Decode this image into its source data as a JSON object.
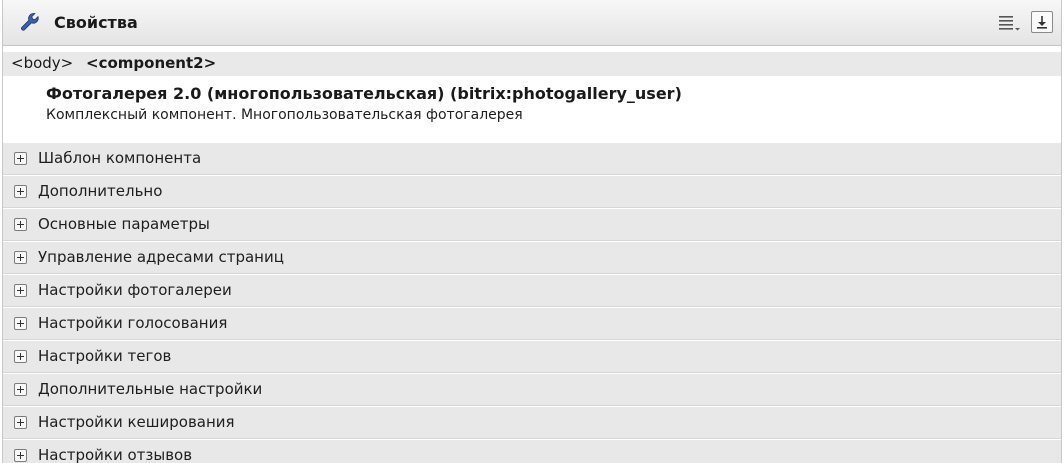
{
  "header": {
    "title": "Свойства",
    "wrench_icon": "wrench-icon",
    "list_icon": "list-view-icon",
    "export_icon": "download-icon"
  },
  "path": {
    "body": "<body>",
    "component": "<component2>"
  },
  "component": {
    "name": "Фотогалерея 2.0 (многопользовательская) (bitrix:photogallery_user)",
    "description": "Комплексный компонент. Многопользовательская фотогалерея"
  },
  "sections": [
    {
      "label": "Шаблон компонента"
    },
    {
      "label": "Дополнительно"
    },
    {
      "label": "Основные параметры"
    },
    {
      "label": "Управление адресами страниц"
    },
    {
      "label": "Настройки фотогалереи"
    },
    {
      "label": "Настройки голосования"
    },
    {
      "label": "Настройки тегов"
    },
    {
      "label": "Дополнительные настройки"
    },
    {
      "label": "Настройки кеширования"
    },
    {
      "label": "Настройки отзывов"
    }
  ]
}
